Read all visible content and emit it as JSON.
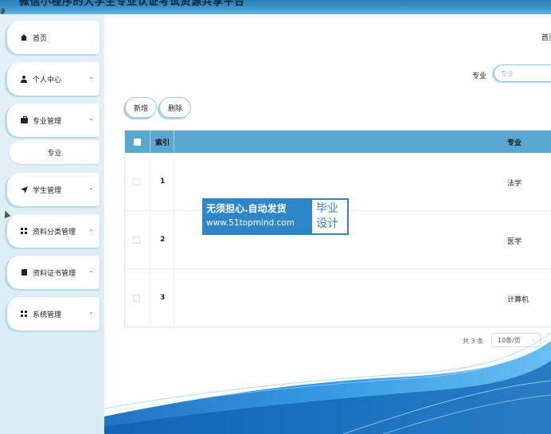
{
  "header": {
    "title": "微信小程序的大学生专业认证考试资源共享平台"
  },
  "edge_glyph": "者",
  "sidebar": {
    "items": [
      {
        "label": "首页",
        "icon": "home-icon",
        "expandable": false
      },
      {
        "label": "个人中心",
        "icon": "user-icon",
        "expandable": true
      },
      {
        "label": "专业管理",
        "icon": "briefcase-icon",
        "expandable": true
      },
      {
        "label": "学生管理",
        "icon": "send-icon",
        "expandable": true
      },
      {
        "label": "资料分类管理",
        "icon": "grid-icon",
        "expandable": true
      },
      {
        "label": "资料证书管理",
        "icon": "certificate-icon",
        "expandable": true
      },
      {
        "label": "系统管理",
        "icon": "grid-icon",
        "expandable": true
      }
    ],
    "sub_item": {
      "label": "专业"
    },
    "chevron": "⌄"
  },
  "main": {
    "breadcrumb": "首页",
    "search": {
      "label": "专业",
      "placeholder": "专业"
    },
    "buttons": {
      "add": "新增",
      "delete": "删除"
    },
    "table": {
      "headers": {
        "index": "索引",
        "major": "专业"
      },
      "rows": [
        {
          "index": "1",
          "major": "法学"
        },
        {
          "index": "2",
          "major": "医学"
        },
        {
          "index": "3",
          "major": "计算机"
        }
      ]
    },
    "pagination": {
      "total": "共 3 条",
      "page_size": "10条/页"
    }
  },
  "watermark": {
    "line1": "无须担心.自动发货",
    "line2": "www.51topmind.com",
    "right_line1": "毕业",
    "right_line2": "设计"
  },
  "colors": {
    "accent": "#5aa8d1",
    "header": "#3b98cc",
    "sidebar_bg": "#e4f1f7",
    "watermark": "#2e86c9"
  }
}
